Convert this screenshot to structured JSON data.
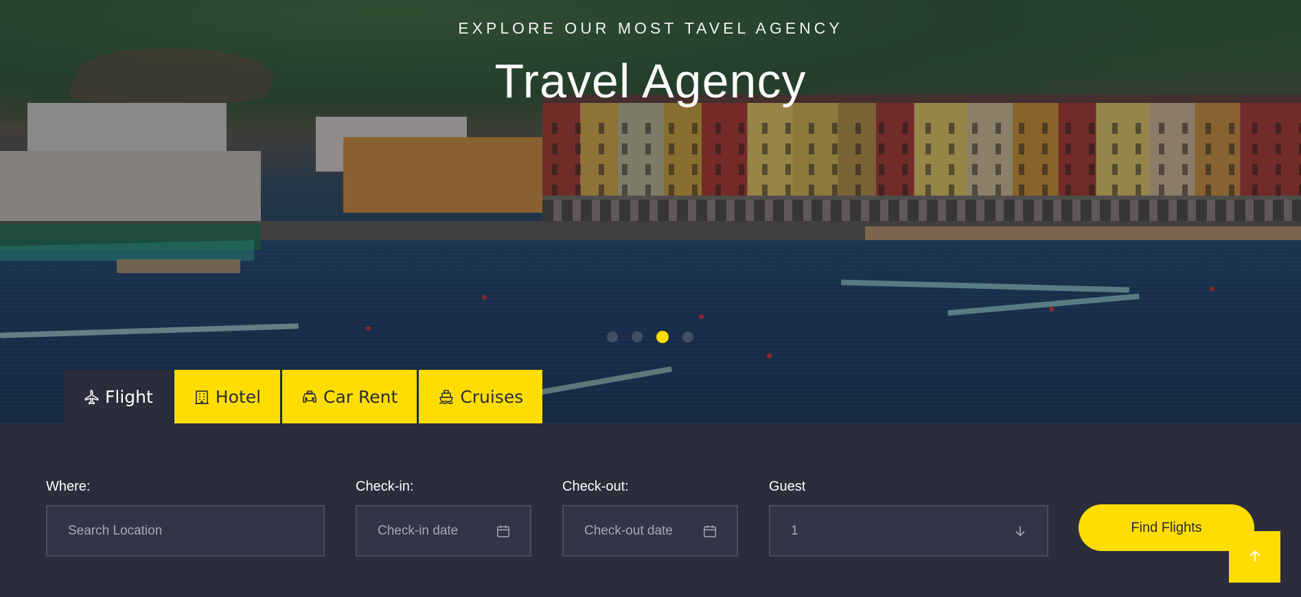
{
  "hero": {
    "eyebrow": "EXPLORE OUR MOST TAVEL AGENCY",
    "title": "Travel Agency",
    "slider": {
      "slide_count": 4,
      "active_index": 2
    }
  },
  "tabs": [
    {
      "label": "Flight",
      "icon": "plane-icon",
      "active": true
    },
    {
      "label": "Hotel",
      "icon": "hotel-icon",
      "active": false
    },
    {
      "label": "Car Rent",
      "icon": "car-icon",
      "active": false
    },
    {
      "label": "Cruises",
      "icon": "ship-icon",
      "active": false
    }
  ],
  "search": {
    "where": {
      "label": "Where:",
      "placeholder": "Search Location"
    },
    "checkin": {
      "label": "Check-in:",
      "placeholder": "Check-in date",
      "icon": "calendar-icon"
    },
    "checkout": {
      "label": "Check-out:",
      "placeholder": "Check-out date",
      "icon": "calendar-icon"
    },
    "guest": {
      "label": "Guest",
      "value": "1",
      "icon": "arrow-down-icon"
    },
    "submit_label": "Find Flights"
  },
  "back_to_top": {
    "icon": "arrow-up-icon"
  },
  "colors": {
    "accent": "#ffdd00",
    "panel": "#2b2d3b",
    "field_bg": "#333546",
    "field_border": "#4a4d5c"
  }
}
